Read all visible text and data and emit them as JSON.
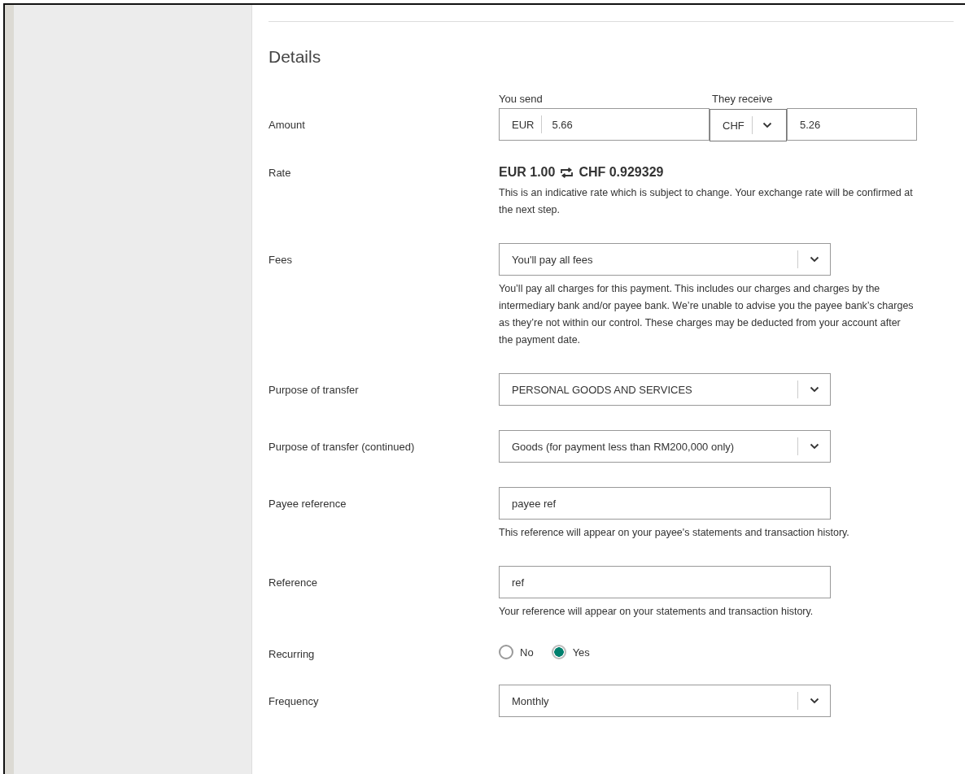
{
  "section_title": "Details",
  "rows": [
    {
      "kind": "amount",
      "label": "Amount",
      "send": {
        "caption": "You send",
        "currency": "EUR",
        "value": "5.66"
      },
      "receive": {
        "caption": "They receive",
        "currency": "CHF",
        "value": "5.26"
      }
    },
    {
      "kind": "rate",
      "label": "Rate",
      "from": "EUR 1.00",
      "to": "CHF 0.929329",
      "hint": "This is an indicative rate which is subject to change. Your exchange rate will be confirmed at the next step."
    },
    {
      "kind": "select",
      "label": "Fees",
      "value": "You'll pay all fees",
      "hint": "You’ll pay all charges for this payment. This includes our charges and charges by the intermediary bank and/or payee bank. We’re unable to advise you the payee bank’s charges as they’re not within our control. These charges may be deducted from your account after the payment date."
    },
    {
      "kind": "select",
      "label": "Purpose of transfer",
      "value": "PERSONAL GOODS AND SERVICES"
    },
    {
      "kind": "select",
      "label": "Purpose of transfer (continued)",
      "value": "Goods (for payment less than RM200,000 only)"
    },
    {
      "kind": "text",
      "label": "Payee reference",
      "value": "payee ref",
      "hint": "This reference will appear on your payee's statements and transaction history."
    },
    {
      "kind": "text",
      "label": "Reference",
      "value": "ref",
      "hint": "Your reference will appear on your statements and transaction history."
    },
    {
      "kind": "radio",
      "label": "Recurring",
      "options": [
        {
          "label": "No",
          "selected": false
        },
        {
          "label": "Yes",
          "selected": true
        }
      ]
    },
    {
      "kind": "select",
      "label": "Frequency",
      "value": "Monthly"
    }
  ]
}
